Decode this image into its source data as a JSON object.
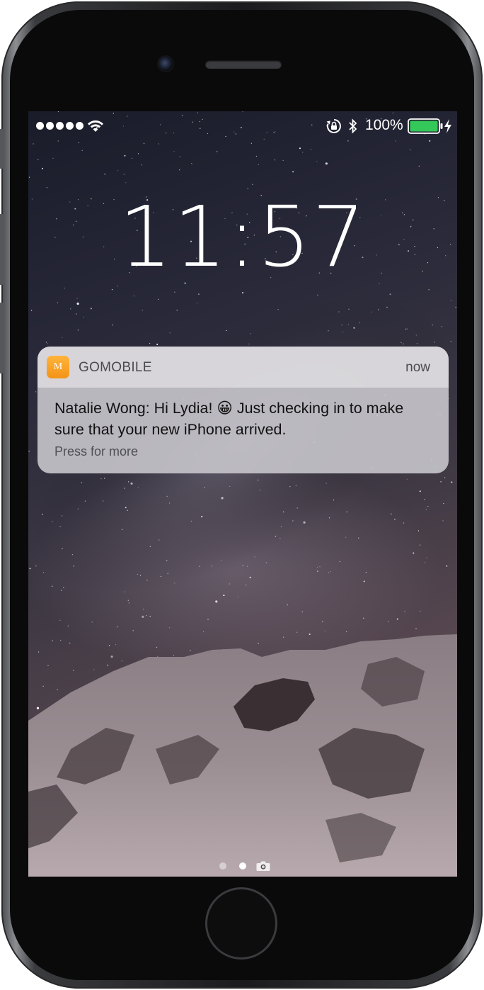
{
  "status_bar": {
    "signal_bars": 5,
    "battery_percent": "100%",
    "battery_level": 1.0,
    "battery_color": "#34c759",
    "icons": [
      "signal-dots",
      "wifi-icon",
      "lock-rotation-icon",
      "bluetooth-icon",
      "battery-icon",
      "charging-icon"
    ]
  },
  "lock_screen": {
    "time": "11:57"
  },
  "notification": {
    "app_icon_letter": "M",
    "app_icon_color": "#f7a01f",
    "app_name": "GOMOBILE",
    "timestamp": "now",
    "message": "Natalie Wong: Hi Lydia! 😀 Just checking in to make sure that your new iPhone arrived.",
    "hint": "Press for more"
  },
  "page_indicator": {
    "pages": 2,
    "current_page": 2,
    "camera_shortcut": "camera-icon"
  },
  "device": {
    "frame_color": "#1b1b1d",
    "wallpaper": "starry night sky over snowy mountain"
  }
}
